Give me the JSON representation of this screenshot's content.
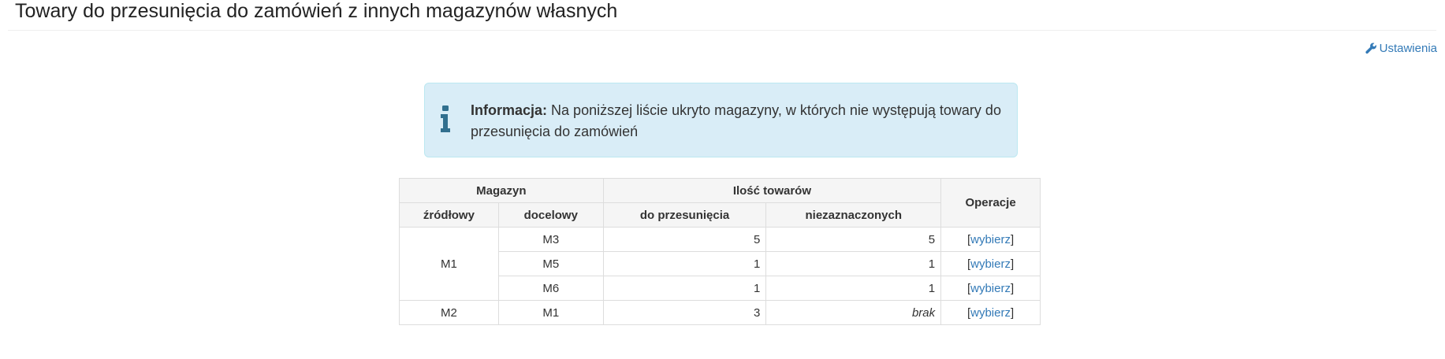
{
  "header": {
    "title": "Towary do przesunięcia do zamówień z innych magazynów własnych",
    "settings_label": "Ustawienia"
  },
  "info": {
    "label": "Informacja:",
    "text": "Na poniższej liście ukryto magazyny, w których nie występują towary do przesunięcia do zamówień"
  },
  "table": {
    "group_headers": {
      "warehouse": "Magazyn",
      "quantity": "Ilość towarów",
      "operations": "Operacje"
    },
    "sub_headers": {
      "source": "źródłowy",
      "target": "docelowy",
      "to_move": "do przesunięcia",
      "unmarked": "niezaznaczonych"
    },
    "groups": [
      {
        "source": "M1",
        "rows": [
          {
            "target": "M3",
            "to_move": "5",
            "unmarked": "5",
            "action": "wybierz"
          },
          {
            "target": "M5",
            "to_move": "1",
            "unmarked": "1",
            "action": "wybierz"
          },
          {
            "target": "M6",
            "to_move": "1",
            "unmarked": "1",
            "action": "wybierz"
          }
        ]
      },
      {
        "source": "M2",
        "rows": [
          {
            "target": "M1",
            "to_move": "3",
            "unmarked": "brak",
            "unmarked_italic": true,
            "action": "wybierz"
          }
        ]
      }
    ]
  },
  "colors": {
    "link": "#337ab7",
    "info_bg": "#d9edf7",
    "info_border": "#bce8f1",
    "info_icon": "#31708f"
  }
}
